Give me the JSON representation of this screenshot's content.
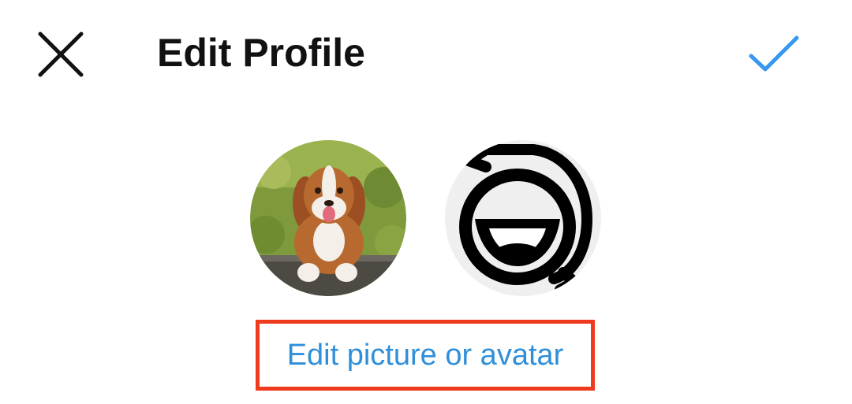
{
  "header": {
    "title": "Edit Profile",
    "close_icon": "close-icon",
    "confirm_icon": "checkmark-icon",
    "confirm_color": "#3897f0"
  },
  "profile": {
    "photo_icon": "profile-photo-dog",
    "avatar_icon": "avatar-sticker-icon",
    "edit_link": "Edit picture or avatar",
    "link_color": "#2f8fd8",
    "highlight_color": "#f03a1d"
  }
}
